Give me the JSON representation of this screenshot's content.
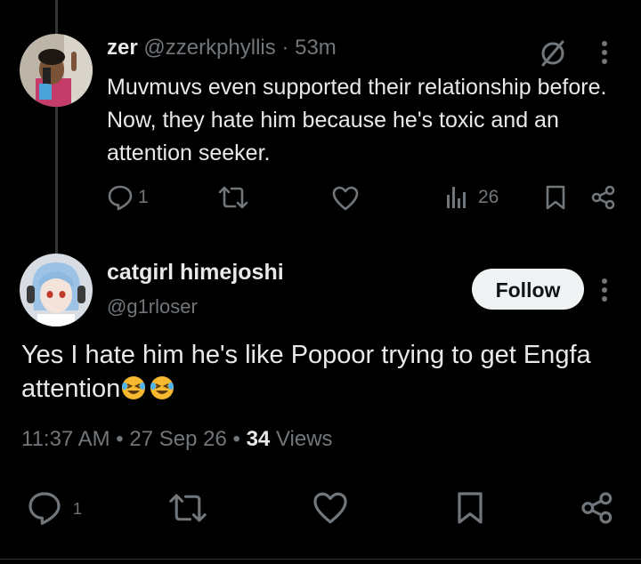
{
  "reply": {
    "name": "zer",
    "handle": "@zzerkphyllis",
    "separator": "·",
    "time": "53m",
    "text": "Muvmuvs even supported their relationship before. Now, they hate him because he's toxic and an attention seeker.",
    "reply_count": "1",
    "views": "26",
    "icons": [
      "grok-icon",
      "more-icon",
      "reply-icon",
      "retweet-icon",
      "like-icon",
      "views-icon",
      "bookmark-icon",
      "share-icon"
    ]
  },
  "post": {
    "name": "catgirl himejoshi",
    "handle": "@g1rloser",
    "follow_label": "Follow",
    "text": "Yes I hate him he's like Popoor trying to get Engfa attention",
    "emojis": [
      "rolling-on-floor-laughing",
      "rolling-on-floor-laughing"
    ],
    "time": "11:37 AM",
    "dot1": "•",
    "date": "27 Sep 26",
    "dot2": "•",
    "views_count": "34",
    "views_label": "Views",
    "reply_count": "1"
  },
  "colors": {
    "background": "#000000",
    "text": "#e7e9ea",
    "muted": "#71767b",
    "follow_bg": "#eff3f4",
    "emoji": "#f5b82e"
  }
}
